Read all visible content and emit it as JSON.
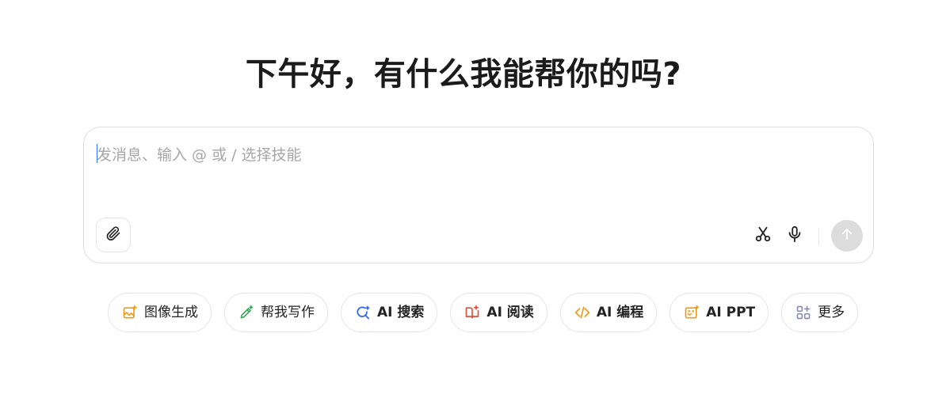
{
  "greeting": "下午好，有什么我能帮你的吗?",
  "composer": {
    "placeholder": "发消息、输入 @ 或 / 选择技能",
    "value": ""
  },
  "toolbar": {
    "attach_icon": "paperclip-icon",
    "scissors_icon": "scissors-icon",
    "mic_icon": "microphone-icon",
    "send_icon": "arrow-up-icon"
  },
  "chips": [
    {
      "label": "图像生成",
      "icon": "image-sparkle-icon",
      "color": "#f09a1a"
    },
    {
      "label": "帮我写作",
      "icon": "pen-sparkle-icon",
      "color": "#3aa65a"
    },
    {
      "label": "AI 搜索",
      "icon": "search-sparkle-icon",
      "color": "#2f6bff"
    },
    {
      "label": "AI 阅读",
      "icon": "book-open-icon",
      "color": "#e54b3a"
    },
    {
      "label": "AI 编程",
      "icon": "code-icon",
      "color": "#f09a1a"
    },
    {
      "label": "AI PPT",
      "icon": "presentation-icon",
      "color": "#f09a1a"
    },
    {
      "label": "更多",
      "icon": "grid-more-icon",
      "color": "#8a8fb0"
    }
  ],
  "colors": {
    "accent": "#2f6bff",
    "send_disabled": "#dcdcdc",
    "border": "#dedede"
  }
}
